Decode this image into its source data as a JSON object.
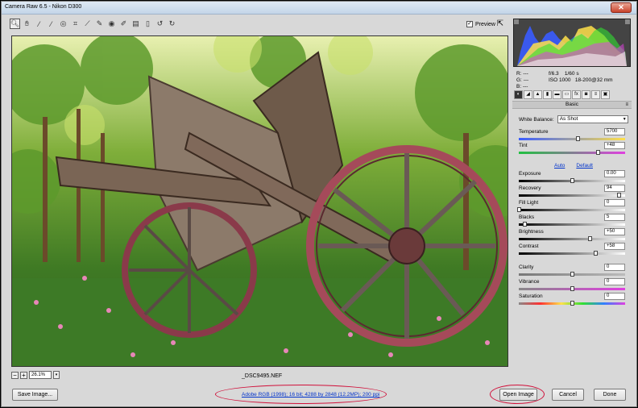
{
  "window": {
    "title": "Camera Raw 6.5  -  Nikon D300"
  },
  "toolbar": {
    "tools": [
      "zoom-icon",
      "hand-icon",
      "white-balance-icon",
      "color-sampler-icon",
      "target-adjust-icon",
      "crop-icon",
      "straighten-icon",
      "spot-removal-icon",
      "red-eye-icon",
      "adjustment-brush-icon",
      "graduated-filter-icon",
      "preferences-icon",
      "rotate-left-icon",
      "rotate-right-icon"
    ],
    "preview_label": "Preview",
    "preview_checked": "✓"
  },
  "status": {
    "zoom_value": "26.1%",
    "filename": "_DSC9495.NEF"
  },
  "info": {
    "r_label": "R:",
    "g_label": "G:",
    "b_label": "B:",
    "dash": "---",
    "aperture": "f/6.3",
    "shutter": "1/60 s",
    "iso": "ISO 1000",
    "lens": "18-200@32 mm"
  },
  "panel": {
    "title": "Basic",
    "white_balance_label": "White Balance:",
    "white_balance_value": "As Shot",
    "auto_label": "Auto",
    "default_label": "Default",
    "sliders": [
      {
        "label": "Temperature",
        "value": "5700",
        "level": 0.55,
        "gradient": "linear-gradient(90deg,#3a5cff,#ffe14a)"
      },
      {
        "label": "Tint",
        "value": "+48",
        "level": 0.74,
        "gradient": "linear-gradient(90deg,#20c040,#e040e0)"
      },
      {
        "label": "Exposure",
        "value": "0.00",
        "level": 0.5,
        "gradient": "linear-gradient(90deg,#000,#fff)"
      },
      {
        "label": "Recovery",
        "value": "94",
        "level": 0.94,
        "gradient": "linear-gradient(90deg,#000,#fff)"
      },
      {
        "label": "Fill Light",
        "value": "0",
        "level": 0.0,
        "gradient": "linear-gradient(90deg,#000,#fff)"
      },
      {
        "label": "Blacks",
        "value": "5",
        "level": 0.05,
        "gradient": "linear-gradient(90deg,#000,#fff)"
      },
      {
        "label": "Brightness",
        "value": "+50",
        "level": 0.67,
        "gradient": "linear-gradient(90deg,#000,#fff)"
      },
      {
        "label": "Contrast",
        "value": "+58",
        "level": 0.72,
        "gradient": "linear-gradient(90deg,#000,#fff)"
      },
      {
        "label": "Clarity",
        "value": "0",
        "level": 0.5,
        "gradient": "linear-gradient(90deg,#777,#bbb)"
      },
      {
        "label": "Vibrance",
        "value": "0",
        "level": 0.5,
        "gradient": "linear-gradient(90deg,#888,#e040e0)"
      },
      {
        "label": "Saturation",
        "value": "0",
        "level": 0.5,
        "gradient": "linear-gradient(90deg,#888,#ff3030,#ffe14a,#30e030,#3080ff,#e040e0)"
      }
    ]
  },
  "bottom": {
    "save_label": "Save Image...",
    "workflow_link": "Adobe RGB (1998); 16 bit; 4288 by 2848 (12.2MP); 200 ppi",
    "open_label": "Open Image",
    "cancel_label": "Cancel",
    "done_label": "Done"
  },
  "colors": {
    "highlight": "#d0103a",
    "link": "#0033cc"
  }
}
